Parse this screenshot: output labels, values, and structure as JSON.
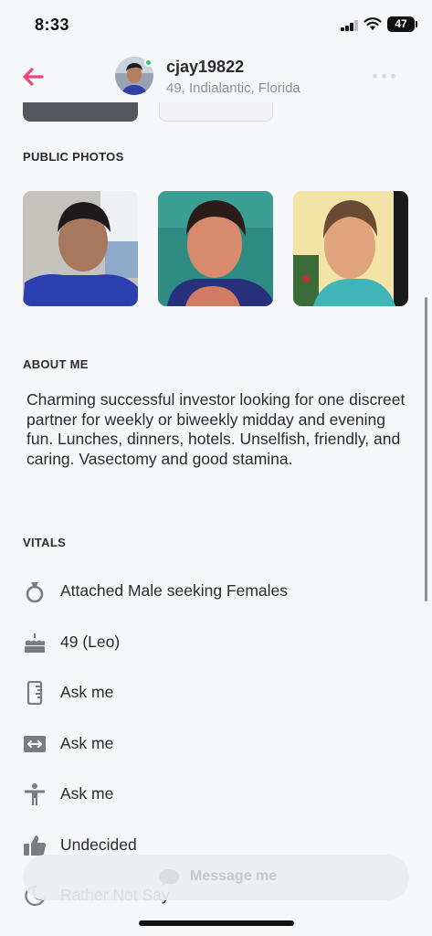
{
  "status_bar": {
    "time": "8:33",
    "battery": "47"
  },
  "header": {
    "username": "cjay19822",
    "subtitle": "49, Indialantic, Florida"
  },
  "sections": {
    "public_photos": "PUBLIC PHOTOS",
    "about_me": "ABOUT ME",
    "vitals": "VITALS"
  },
  "about_text": "Charming successful investor looking for one discreet partner for weekly or biweekly midday and evening fun. Lunches, dinners, hotels. Unselfish, friendly, and caring. Vasectomy and good stamina.",
  "vitals": [
    {
      "icon": "ring-icon",
      "label": "Attached Male seeking Females"
    },
    {
      "icon": "cake-icon",
      "label": "49 (Leo)"
    },
    {
      "icon": "ruler-icon",
      "label": "Ask me"
    },
    {
      "icon": "width-arrows-icon",
      "label": "Ask me"
    },
    {
      "icon": "person-icon",
      "label": "Ask me"
    },
    {
      "icon": "thumbs-up-icon",
      "label": "Undecided"
    },
    {
      "icon": "moon-icon",
      "label": "Rather Not Say"
    }
  ],
  "message_button": "Message me",
  "colors": {
    "accent": "#f0457b",
    "online": "#34c759",
    "background": "#f6f7f9"
  }
}
